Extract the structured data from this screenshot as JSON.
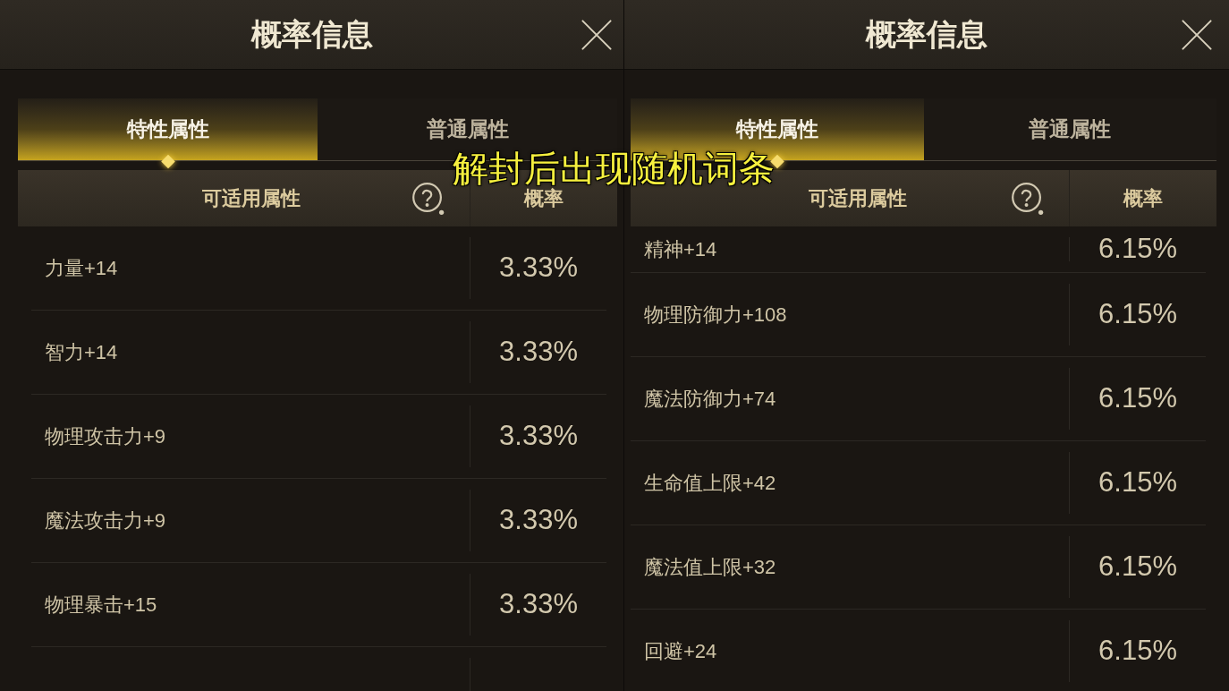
{
  "panels": [
    {
      "title": "概率信息",
      "tabs": [
        {
          "label": "特性属性",
          "selected": true
        },
        {
          "label": "普通属性",
          "selected": false
        }
      ],
      "table": {
        "columns": [
          "可适用属性",
          "概率"
        ],
        "rows": [
          {
            "kind": "full",
            "attribute": "力量+14",
            "probability": "3.33%"
          },
          {
            "kind": "full",
            "attribute": "智力+14",
            "probability": "3.33%"
          },
          {
            "kind": "full",
            "attribute": "物理攻击力+9",
            "probability": "3.33%"
          },
          {
            "kind": "full",
            "attribute": "魔法攻击力+9",
            "probability": "3.33%"
          },
          {
            "kind": "full",
            "attribute": "物理暴击+15",
            "probability": "3.33%"
          }
        ]
      }
    },
    {
      "title": "概率信息",
      "tabs": [
        {
          "label": "特性属性",
          "selected": true
        },
        {
          "label": "普通属性",
          "selected": false
        }
      ],
      "table": {
        "columns": [
          "可适用属性",
          "概率"
        ],
        "rows": [
          {
            "kind": "partial",
            "attribute": "精神+14",
            "probability": "6.15%"
          },
          {
            "kind": "full",
            "attribute": "物理防御力+108",
            "probability": "6.15%"
          },
          {
            "kind": "full",
            "attribute": "魔法防御力+74",
            "probability": "6.15%"
          },
          {
            "kind": "full",
            "attribute": "生命值上限+42",
            "probability": "6.15%"
          },
          {
            "kind": "full",
            "attribute": "魔法值上限+32",
            "probability": "6.15%"
          },
          {
            "kind": "full",
            "attribute": "回避+24",
            "probability": "6.15%"
          }
        ]
      }
    }
  ],
  "caption": "解封后出现随机词条"
}
